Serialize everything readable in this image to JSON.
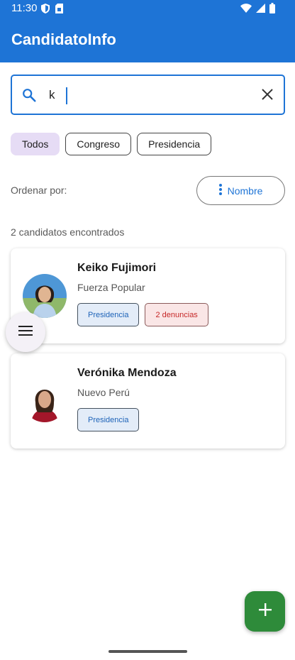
{
  "status_bar": {
    "time": "11:30"
  },
  "app_bar": {
    "title": "CandidatoInfo"
  },
  "search": {
    "value": "k",
    "placeholder": ""
  },
  "filters": [
    {
      "label": "Todos",
      "selected": true
    },
    {
      "label": "Congreso",
      "selected": false
    },
    {
      "label": "Presidencia",
      "selected": false
    }
  ],
  "sort": {
    "label": "Ordenar por:",
    "button_label": "Nombre"
  },
  "results": {
    "count_text": "2 candidatos encontrados"
  },
  "candidates": [
    {
      "name": "Keiko Fujimori",
      "party": "Fuerza Popular",
      "office_tag": "Presidencia",
      "warning_tag": "2 denuncias"
    },
    {
      "name": "Verónika Mendoza",
      "party": "Nuevo Perú",
      "office_tag": "Presidencia"
    }
  ],
  "colors": {
    "primary": "#1e74d6",
    "selected_chip": "#e6dcf5",
    "fab": "#2e8b3a",
    "warning": "#c62828"
  },
  "icons": [
    "shield-icon",
    "sim-card-icon",
    "wifi-icon",
    "signal-icon",
    "battery-icon",
    "search-icon",
    "close-icon",
    "more-vert-icon",
    "menu-icon",
    "add-icon"
  ]
}
